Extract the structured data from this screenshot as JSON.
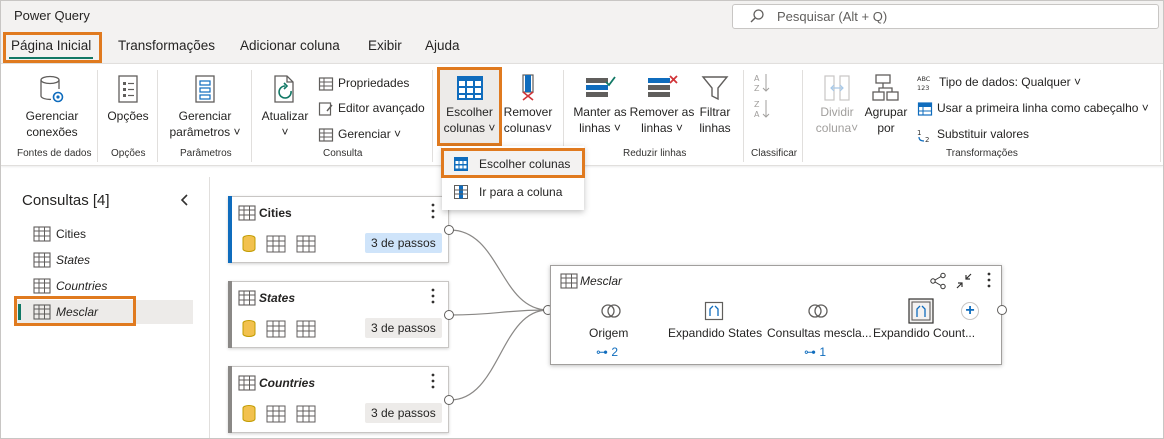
{
  "app": {
    "title": "Power Query"
  },
  "search": {
    "placeholder": "Pesquisar (Alt + Q)"
  },
  "tabs": [
    "Página Inicial",
    "Transformações",
    "Adicionar coluna",
    "Exibir",
    "Ajuda"
  ],
  "ribbon": {
    "manage_connections": [
      "Gerenciar",
      "conexões"
    ],
    "options": "Opções",
    "manage_params": [
      "Gerenciar",
      "parâmetros"
    ],
    "refresh": "Atualizar",
    "properties": "Propriedades",
    "advanced_editor": "Editor avançado",
    "manage": "Gerenciar",
    "choose_columns": [
      "Escolher",
      "colunas"
    ],
    "remove_columns": [
      "Remover",
      "colunas"
    ],
    "keep_rows": [
      "Manter as",
      "linhas"
    ],
    "remove_rows": [
      "Remover as",
      "linhas"
    ],
    "filter_rows": [
      "Filtrar",
      "linhas"
    ],
    "split_column": [
      "Dividir",
      "coluna"
    ],
    "group_by": [
      "Agrupar",
      "por"
    ],
    "data_type": "Tipo de dados: Qualquer",
    "first_row_header": "Usar a primeira linha como cabeçalho",
    "replace_values": "Substituir valores",
    "groups": {
      "data_sources": "Fontes de dados",
      "options": "Opções",
      "parameters": "Parâmetros",
      "query": "Consulta",
      "reduce_rows": "Reduzir linhas",
      "sort": "Classificar",
      "transform": "Transformações"
    }
  },
  "dropdown": {
    "items": [
      "Escolher colunas",
      "Ir para a coluna"
    ]
  },
  "queries": {
    "title": "Consultas [4]",
    "items": [
      "Cities",
      "States",
      "Countries",
      "Mesclar"
    ]
  },
  "diagram": {
    "cards": [
      {
        "name": "Cities",
        "steps": "3 de passos"
      },
      {
        "name": "States",
        "steps": "3 de passos"
      },
      {
        "name": "Countries",
        "steps": "3 de passos"
      }
    ],
    "merge": {
      "title": "Mesclar",
      "steps": [
        "Origem",
        "Expandido States",
        "Consultas mescla...",
        "Expandido Count..."
      ],
      "links": [
        "2",
        "1"
      ]
    }
  },
  "colors": {
    "accent": "#117865",
    "highlight": "#e07a1f",
    "link": "#0f6cbd",
    "badge_active": "#cfe4fa"
  }
}
